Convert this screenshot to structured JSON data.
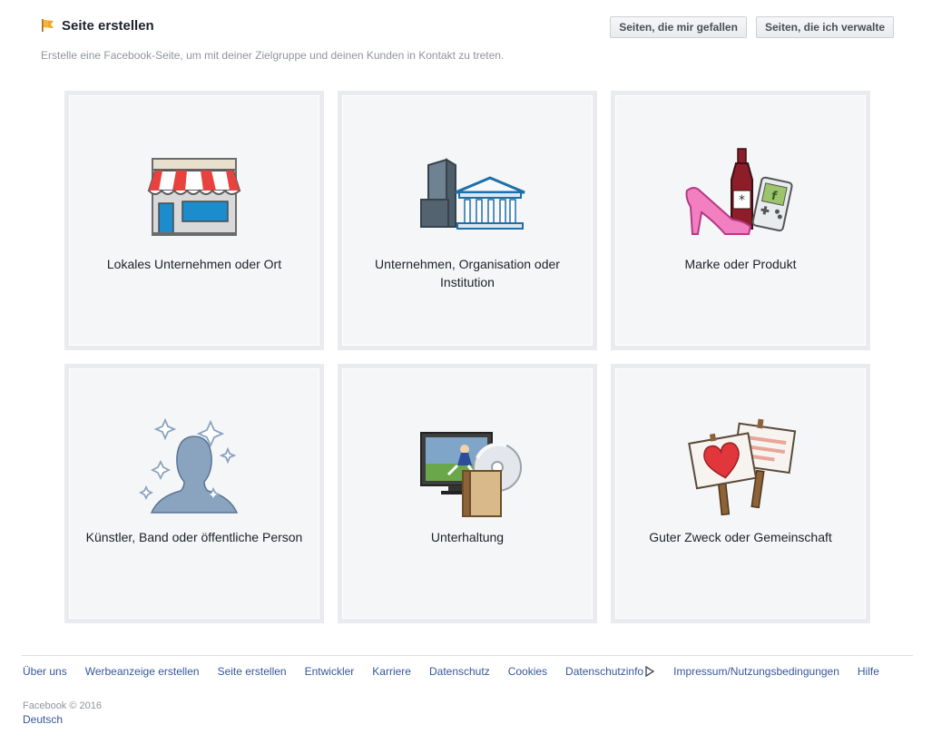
{
  "header": {
    "title": "Seite erstellen",
    "subtitle": "Erstelle eine Facebook-Seite, um mit deiner Zielgruppe und deinen Kunden in Kontakt zu treten.",
    "buttons": [
      "Seiten, die mir gefallen",
      "Seiten, die ich verwalte"
    ]
  },
  "categories": [
    {
      "label": "Lokales Unternehmen oder Ort",
      "icon": "storefront-icon"
    },
    {
      "label": "Unternehmen, Organisation oder Institution",
      "icon": "buildings-icon"
    },
    {
      "label": "Marke oder Produkt",
      "icon": "products-icon"
    },
    {
      "label": "Künstler, Band oder öffentliche Person",
      "icon": "person-silhouette-icon"
    },
    {
      "label": "Unterhaltung",
      "icon": "entertainment-icon"
    },
    {
      "label": "Guter Zweck oder Gemeinschaft",
      "icon": "signs-heart-icon"
    }
  ],
  "footer": {
    "links": [
      "Über uns",
      "Werbeanzeige erstellen",
      "Seite erstellen",
      "Entwickler",
      "Karriere",
      "Datenschutz",
      "Cookies",
      "Datenschutzinfo",
      "Impressum/Nutzungsbedingungen",
      "Hilfe"
    ],
    "copyright": "Facebook © 2016",
    "language": "Deutsch"
  },
  "colors": {
    "link": "#365899",
    "tile_bg": "#f5f6f7",
    "tile_border": "#e9ebee",
    "flag": "#f5a623"
  }
}
